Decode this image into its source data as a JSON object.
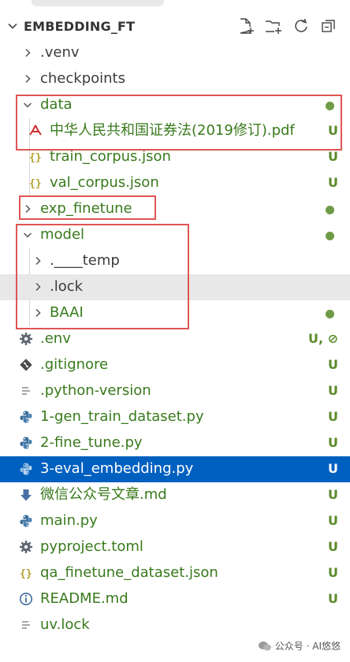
{
  "header": {
    "title": "EMBEDDING_FT"
  },
  "tree": {
    "venv": {
      "label": ".venv"
    },
    "checkpoints": {
      "label": "checkpoints"
    },
    "data": {
      "label": "data"
    },
    "pdf": {
      "label": "中华人民共和国证券法(2019修订).pdf",
      "status": "U"
    },
    "train_corpus": {
      "label": "train_corpus.json",
      "status": "U"
    },
    "val_corpus": {
      "label": "val_corpus.json",
      "status": "U"
    },
    "exp_finetune": {
      "label": "exp_finetune"
    },
    "model": {
      "label": "model"
    },
    "temp": {
      "label": ".____temp"
    },
    "lock_dir": {
      "label": ".lock"
    },
    "baai": {
      "label": "BAAI"
    },
    "env": {
      "label": ".env",
      "status": "U, ⊘"
    },
    "gitignore": {
      "label": ".gitignore",
      "status": "U"
    },
    "python_version": {
      "label": ".python-version",
      "status": "U"
    },
    "gen_train": {
      "label": "1-gen_train_dataset.py",
      "status": "U"
    },
    "fine_tune": {
      "label": "2-fine_tune.py",
      "status": "U"
    },
    "eval_embedding": {
      "label": "3-eval_embedding.py",
      "status": "U"
    },
    "wechat_md": {
      "label": "微信公众号文章.md",
      "status": "U"
    },
    "main_py": {
      "label": "main.py",
      "status": "U"
    },
    "pyproject": {
      "label": "pyproject.toml",
      "status": "U"
    },
    "qa_dataset": {
      "label": "qa_finetune_dataset.json",
      "status": "U"
    },
    "readme": {
      "label": "README.md",
      "status": "U"
    },
    "uv_lock": {
      "label": "uv.lock",
      "status": "U"
    }
  },
  "watermark": {
    "text": "公众号 · AI悠悠"
  },
  "colors": {
    "selection": "#0060c0",
    "untracked_green": "#387a1c",
    "highlight_box": "#e05454"
  }
}
